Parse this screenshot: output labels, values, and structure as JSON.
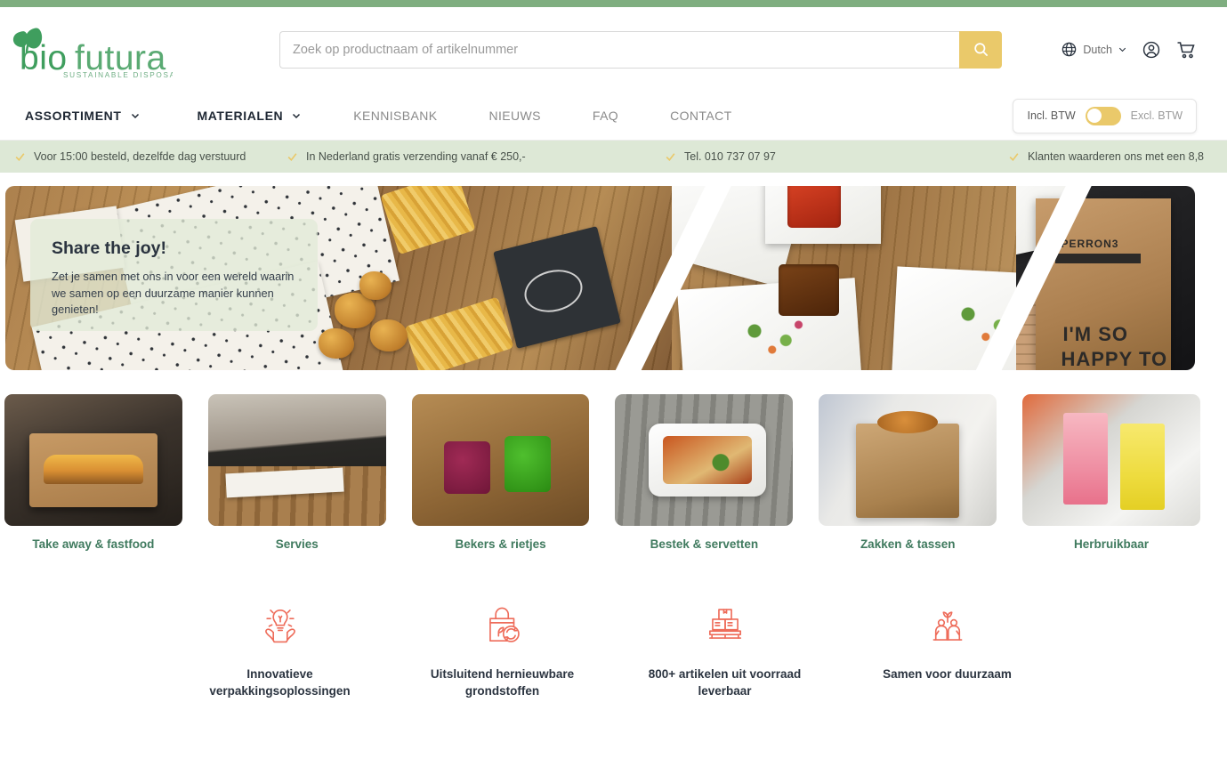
{
  "brand": {
    "name_part1": "bio",
    "name_part2": "futura",
    "tagline": "SUSTAINABLE DISPOSABLES",
    "green": "#3f9e5e",
    "accent_yellow": "#eac96a",
    "accent_coral": "#ee6c5a",
    "label_green": "#3f7a5e"
  },
  "search": {
    "placeholder": "Zoek op productnaam of artikelnummer",
    "value": "",
    "button_icon": "search-icon"
  },
  "header": {
    "language": "Dutch",
    "language_icon": "globe-icon",
    "language_chevron": "chevron-down-icon",
    "account_icon": "user-circle-icon",
    "cart_icon": "shopping-cart-icon"
  },
  "nav": {
    "items": [
      {
        "label": "ASSORTIMENT",
        "has_chevron": true,
        "strong": true
      },
      {
        "label": "MATERIALEN",
        "has_chevron": true,
        "strong": true
      },
      {
        "label": "KENNISBANK",
        "has_chevron": false,
        "strong": false
      },
      {
        "label": "NIEUWS",
        "has_chevron": false,
        "strong": false
      },
      {
        "label": "FAQ",
        "has_chevron": false,
        "strong": false
      },
      {
        "label": "CONTACT",
        "has_chevron": false,
        "strong": false
      }
    ],
    "vat_toggle": {
      "left_label": "Incl. BTW",
      "right_label": "Excl. BTW",
      "state": "incl"
    }
  },
  "usp_strip": {
    "items": [
      "Voor 15:00 besteld, dezelfde dag verstuurd",
      "In Nederland gratis verzending vanaf € 250,-",
      "Tel. 010 737 07 97",
      "Klanten waarderen ons met een 8,8"
    ]
  },
  "hero": {
    "title": "Share the joy!",
    "subtitle": "Zet je samen met ons in voor een wereld waarin we samen op een duurzame manier kunnen genieten!",
    "bag_text_line1": "PERRON3",
    "bag_text_line2": "I'M SO",
    "bag_text_line3": "HAPPY TO"
  },
  "categories": [
    {
      "label": "Take away & fastfood"
    },
    {
      "label": "Servies"
    },
    {
      "label": "Bekers & rietjes"
    },
    {
      "label": "Bestek & servetten"
    },
    {
      "label": "Zakken & tassen"
    },
    {
      "label": "Herbruikbaar"
    }
  ],
  "usp_icons": [
    {
      "icon": "lightbulb-in-hands-icon",
      "label": "Innovatieve verpakkingsoplossingen"
    },
    {
      "icon": "recyclable-bag-icon",
      "label": "Uitsluitend hernieuwbare grondstoffen"
    },
    {
      "icon": "boxes-on-pallet-icon",
      "label": "800+ artikelen uit voorraad leverbaar"
    },
    {
      "icon": "people-with-plant-icon",
      "label": "Samen voor  duurzaam"
    }
  ]
}
